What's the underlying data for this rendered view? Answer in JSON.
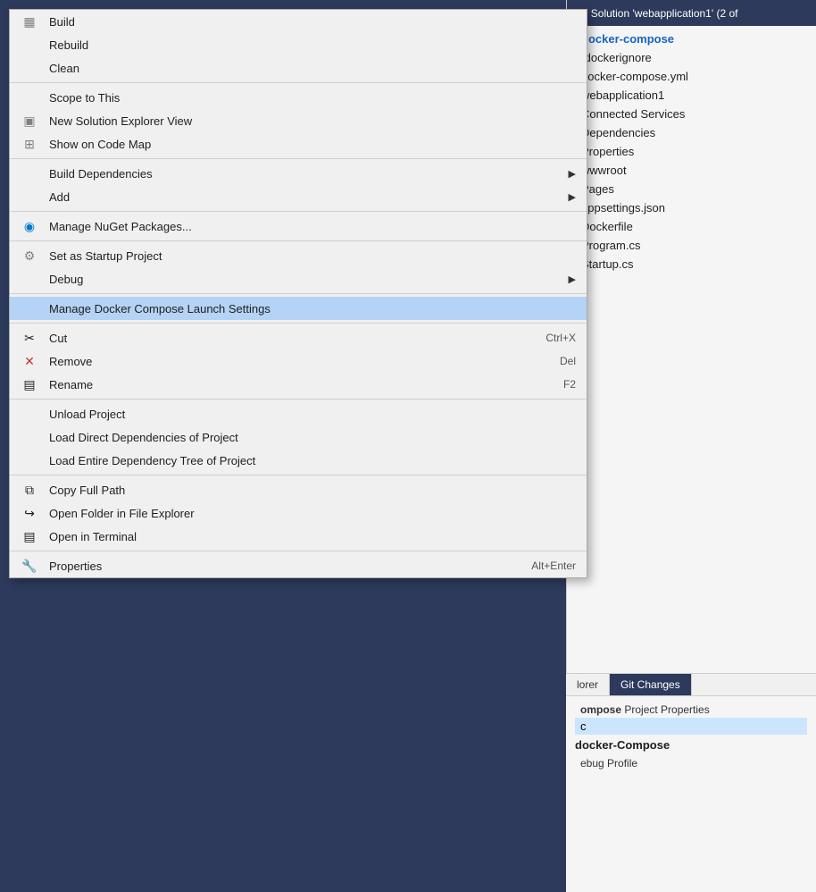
{
  "solution_explorer": {
    "header_text": "Solution 'webapplication1' (2 of",
    "header_icon": "◆",
    "tree_items": [
      {
        "label": "docker-compose",
        "bold": true,
        "highlighted": false
      },
      {
        "label": ".dockerignore",
        "bold": false,
        "highlighted": false
      },
      {
        "label": "docker-compose.yml",
        "bold": false,
        "highlighted": false
      },
      {
        "label": "webapplication1",
        "bold": false,
        "highlighted": false
      },
      {
        "label": "Connected Services",
        "bold": false,
        "highlighted": false
      },
      {
        "label": "Dependencies",
        "bold": false,
        "highlighted": false
      },
      {
        "label": "Properties",
        "bold": false,
        "highlighted": false
      },
      {
        "label": "wwwroot",
        "bold": false,
        "highlighted": false
      },
      {
        "label": "Pages",
        "bold": false,
        "highlighted": false
      },
      {
        "label": "appsettings.json",
        "bold": false,
        "highlighted": false
      },
      {
        "label": "Dockerfile",
        "bold": false,
        "highlighted": false
      },
      {
        "label": "Program.cs",
        "bold": false,
        "highlighted": false
      },
      {
        "label": "Startup.cs",
        "bold": false,
        "highlighted": false
      }
    ]
  },
  "bottom_tabs": [
    {
      "label": "lorer",
      "active": false
    },
    {
      "label": "Git Changes",
      "active": true
    }
  ],
  "bottom_panel": {
    "title": "docker-Compose",
    "section1_label": "ompose",
    "section1_value": "Project Properties",
    "section2_row1": "c",
    "section3_title": "docker-Compose",
    "section3_row1": "ebug Profile"
  },
  "context_menu": {
    "items": [
      {
        "id": "build",
        "label": "Build",
        "icon": "build",
        "shortcut": "",
        "has_arrow": false,
        "highlighted": false,
        "divider_after": false
      },
      {
        "id": "rebuild",
        "label": "Rebuild",
        "icon": "",
        "shortcut": "",
        "has_arrow": false,
        "highlighted": false,
        "divider_after": false
      },
      {
        "id": "clean",
        "label": "Clean",
        "icon": "",
        "shortcut": "",
        "has_arrow": false,
        "highlighted": false,
        "divider_after": true
      },
      {
        "id": "scope-to-this",
        "label": "Scope to This",
        "icon": "",
        "shortcut": "",
        "has_arrow": false,
        "highlighted": false,
        "divider_after": false
      },
      {
        "id": "new-solution-explorer-view",
        "label": "New Solution Explorer View",
        "icon": "explorer",
        "shortcut": "",
        "has_arrow": false,
        "highlighted": false,
        "divider_after": false
      },
      {
        "id": "show-on-code-map",
        "label": "Show on Code Map",
        "icon": "map",
        "shortcut": "",
        "has_arrow": false,
        "highlighted": false,
        "divider_after": true
      },
      {
        "id": "build-dependencies",
        "label": "Build Dependencies",
        "icon": "",
        "shortcut": "",
        "has_arrow": true,
        "highlighted": false,
        "divider_after": false
      },
      {
        "id": "add",
        "label": "Add",
        "icon": "",
        "shortcut": "",
        "has_arrow": true,
        "highlighted": false,
        "divider_after": true
      },
      {
        "id": "manage-nuget",
        "label": "Manage NuGet Packages...",
        "icon": "nuget",
        "shortcut": "",
        "has_arrow": false,
        "highlighted": false,
        "divider_after": true
      },
      {
        "id": "set-startup",
        "label": "Set as Startup Project",
        "icon": "gear",
        "shortcut": "",
        "has_arrow": false,
        "highlighted": false,
        "divider_after": false
      },
      {
        "id": "debug",
        "label": "Debug",
        "icon": "",
        "shortcut": "",
        "has_arrow": true,
        "highlighted": false,
        "divider_after": true
      },
      {
        "id": "manage-docker",
        "label": "Manage Docker Compose Launch Settings",
        "icon": "",
        "shortcut": "",
        "has_arrow": false,
        "highlighted": true,
        "divider_after": true
      },
      {
        "id": "cut",
        "label": "Cut",
        "icon": "cut",
        "shortcut": "Ctrl+X",
        "has_arrow": false,
        "highlighted": false,
        "divider_after": false
      },
      {
        "id": "remove",
        "label": "Remove",
        "icon": "remove",
        "shortcut": "Del",
        "has_arrow": false,
        "highlighted": false,
        "divider_after": false
      },
      {
        "id": "rename",
        "label": "Rename",
        "icon": "rename",
        "shortcut": "F2",
        "has_arrow": false,
        "highlighted": false,
        "divider_after": true
      },
      {
        "id": "unload-project",
        "label": "Unload Project",
        "icon": "",
        "shortcut": "",
        "has_arrow": false,
        "highlighted": false,
        "divider_after": false
      },
      {
        "id": "load-direct",
        "label": "Load Direct Dependencies of Project",
        "icon": "",
        "shortcut": "",
        "has_arrow": false,
        "highlighted": false,
        "divider_after": false
      },
      {
        "id": "load-entire",
        "label": "Load Entire Dependency Tree of Project",
        "icon": "",
        "shortcut": "",
        "has_arrow": false,
        "highlighted": false,
        "divider_after": true
      },
      {
        "id": "copy-full-path",
        "label": "Copy Full Path",
        "icon": "copy",
        "shortcut": "",
        "has_arrow": false,
        "highlighted": false,
        "divider_after": false
      },
      {
        "id": "open-folder",
        "label": "Open Folder in File Explorer",
        "icon": "folder",
        "shortcut": "",
        "has_arrow": false,
        "highlighted": false,
        "divider_after": false
      },
      {
        "id": "open-terminal",
        "label": "Open in Terminal",
        "icon": "terminal",
        "shortcut": "",
        "has_arrow": false,
        "highlighted": false,
        "divider_after": true
      },
      {
        "id": "properties",
        "label": "Properties",
        "icon": "wrench",
        "shortcut": "Alt+Enter",
        "has_arrow": false,
        "highlighted": false,
        "divider_after": false
      }
    ]
  },
  "icons": {
    "build": "▦",
    "explorer": "▣",
    "map": "⊞",
    "nuget": "◉",
    "gear": "⚙",
    "cut": "✂",
    "remove": "✕",
    "rename": "▤",
    "copy": "⧉",
    "folder": "↪",
    "terminal": "▤",
    "wrench": "🔧",
    "arrow": "▶",
    "vs_icon": "◆"
  }
}
